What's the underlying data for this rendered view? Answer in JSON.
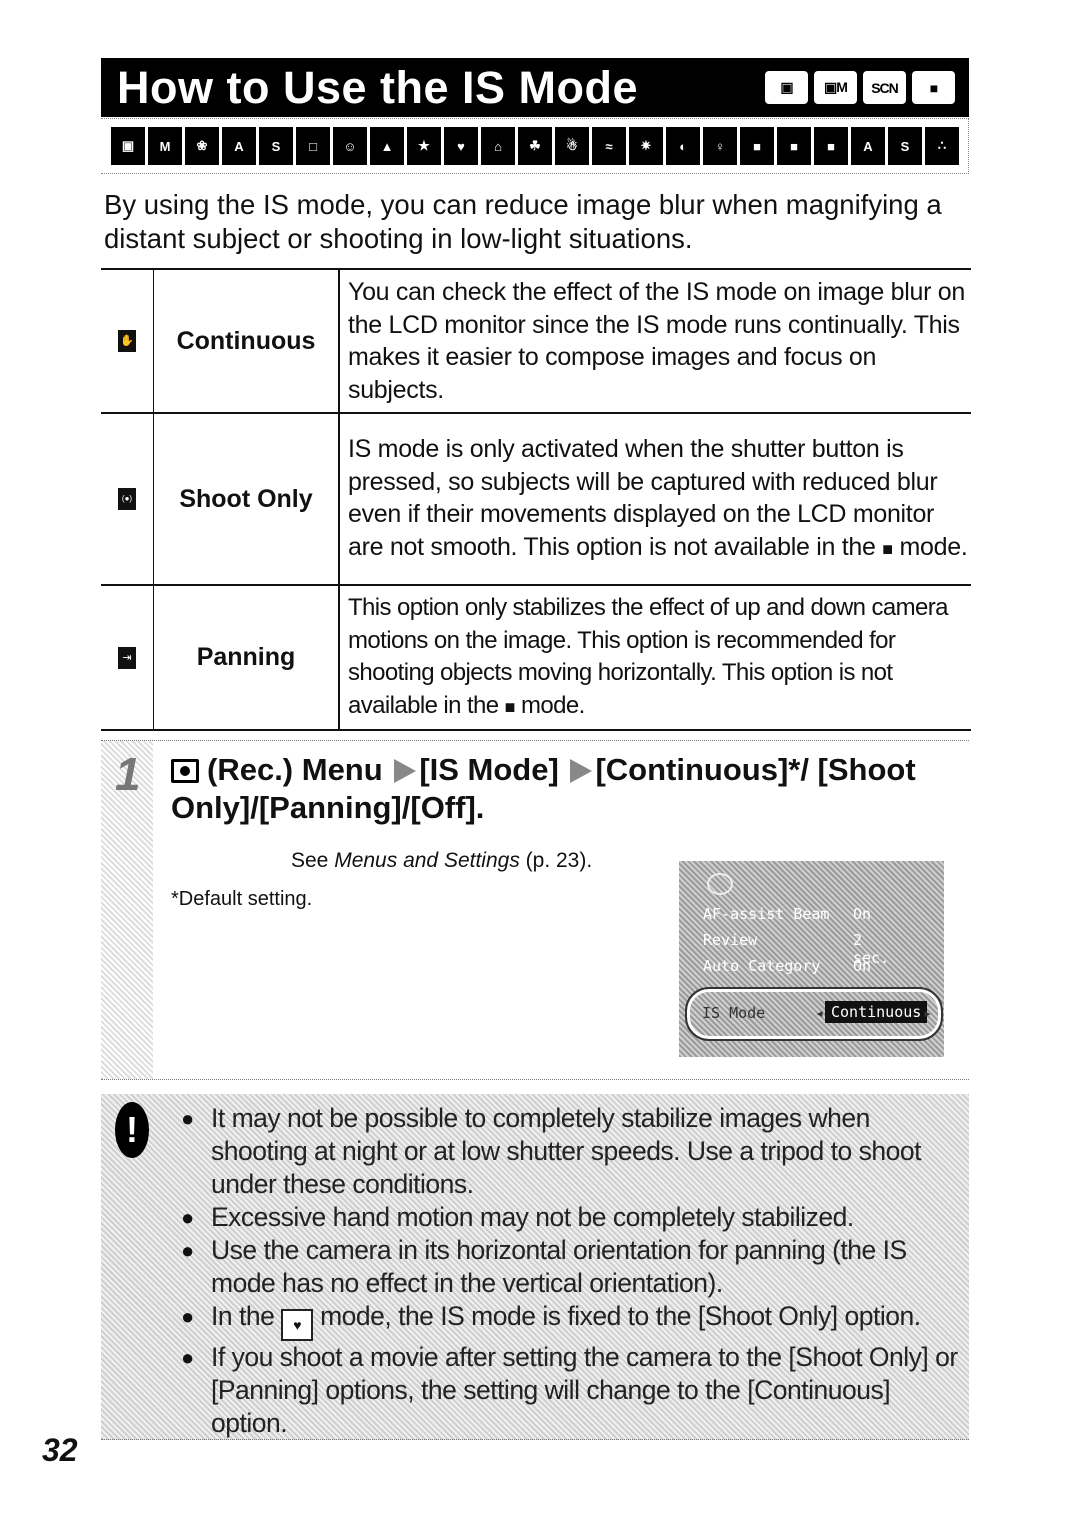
{
  "header": {
    "title": "How to Use the IS Mode",
    "mode_badges": [
      {
        "icon": "camera-auto-icon",
        "label": "▣"
      },
      {
        "icon": "camera-manual-icon",
        "label": "▣M"
      },
      {
        "icon": "scene-icon",
        "label": "SCN"
      },
      {
        "icon": "movie-icon",
        "label": "■"
      }
    ]
  },
  "scene_icons": [
    {
      "name": "auto-icon",
      "glyph": "▣"
    },
    {
      "name": "manual-icon",
      "glyph": "M"
    },
    {
      "name": "digital-macro-icon",
      "glyph": "❀"
    },
    {
      "name": "color-accent-icon",
      "glyph": "A"
    },
    {
      "name": "color-swap-icon",
      "glyph": "S"
    },
    {
      "name": "stitch-assist-icon",
      "glyph": "□"
    },
    {
      "name": "portrait-icon",
      "glyph": "☺"
    },
    {
      "name": "landscape-icon",
      "glyph": "▲"
    },
    {
      "name": "night-snapshot-icon",
      "glyph": "★"
    },
    {
      "name": "kids-pets-icon",
      "glyph": "♥"
    },
    {
      "name": "indoor-icon",
      "glyph": "⌂"
    },
    {
      "name": "foliage-icon",
      "glyph": "☘"
    },
    {
      "name": "snow-icon",
      "glyph": "☃"
    },
    {
      "name": "beach-icon",
      "glyph": "≈"
    },
    {
      "name": "fireworks-icon",
      "glyph": "✷"
    },
    {
      "name": "aquarium-icon",
      "glyph": "◐"
    },
    {
      "name": "underwater-icon",
      "glyph": "♀"
    },
    {
      "name": "movie-standard-icon",
      "glyph": "■"
    },
    {
      "name": "movie-fast-frame-icon",
      "glyph": "■"
    },
    {
      "name": "movie-compact-icon",
      "glyph": "■"
    },
    {
      "name": "movie-color-accent-icon",
      "glyph": "A"
    },
    {
      "name": "movie-color-swap-icon",
      "glyph": "S"
    },
    {
      "name": "movie-time-lapse-icon",
      "glyph": "∴"
    }
  ],
  "intro": "By using the IS mode, you can reduce image blur when magnifying a distant subject or shooting in low-light situations.",
  "options": [
    {
      "icon": "continuous-hand-icon",
      "glyph": "✋",
      "name": "Continuous",
      "description": "You can check the effect of the IS mode on image blur on the LCD monitor since the IS mode runs continually. This makes it easier to compose images and focus on subjects."
    },
    {
      "icon": "shoot-only-icon",
      "glyph": "(●)",
      "name": "Shoot Only",
      "description_before": "IS mode is only activated when the shutter button is pressed, so subjects will be captured with reduced blur even if their movements displayed on the LCD monitor are not smooth. This option is not available in the",
      "movie_glyph": "■",
      "description_after": "mode."
    },
    {
      "icon": "panning-icon",
      "glyph": "⇥",
      "name": "Panning",
      "description_before": "This option only stabilizes the effect of up and down camera motions on the image. This option is recommended for shooting objects moving horizontally. This option is not available in the",
      "movie_glyph": "■",
      "description_after": "mode."
    }
  ],
  "step": {
    "number": "1",
    "heading_part1": "(Rec.) Menu",
    "heading_part2": "[IS Mode]",
    "heading_part3": "[Continuous]*/ [Shoot Only]/[Panning]/[Off].",
    "see_prefix": "See ",
    "see_link": "Menus and Settings",
    "see_suffix": " (p. 23).",
    "default_note": "*Default setting."
  },
  "lcd_screen": {
    "rows": [
      {
        "label": "AF-assist Beam",
        "value": "On"
      },
      {
        "label": "Review",
        "value": "2 sec."
      },
      {
        "label": "Auto Category",
        "value": "On"
      }
    ],
    "selected_label": "IS Mode",
    "selected_value": "Continuous",
    "left_arrow": "◂",
    "right_arrow": "▸"
  },
  "cautions": {
    "icon": "!",
    "items": [
      "It may not be possible to completely stabilize images when shooting at night or at low shutter speeds. Use a tripod to shoot under these conditions.",
      "Excessive hand motion may not be completely stabilized.",
      "Use the camera in its horizontal orientation for panning (the IS mode has no effect in the vertical orientation).",
      {
        "before": "In the",
        "scene_glyph": "♥",
        "after": "mode, the IS mode is fixed to the [Shoot Only] option."
      },
      "If you shoot a movie after setting the camera to the [Shoot Only] or [Panning] options, the setting will change to the [Continuous] option."
    ]
  },
  "page_number": "32"
}
